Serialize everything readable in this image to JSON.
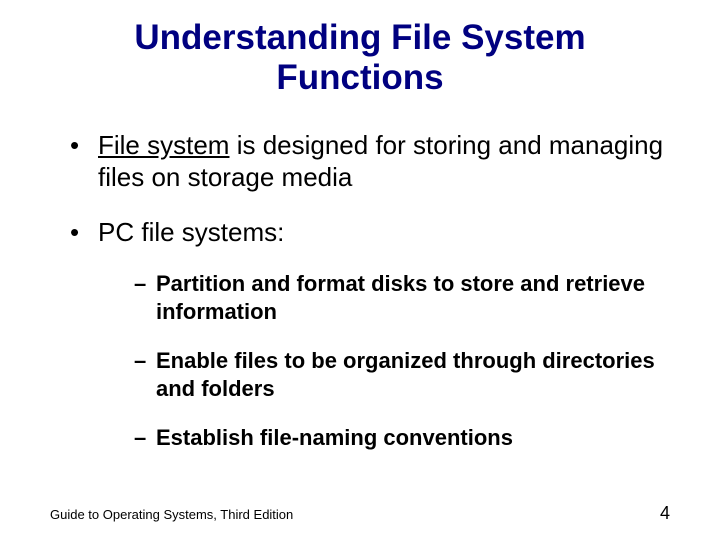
{
  "title": "Understanding File System Functions",
  "bullets": [
    {
      "prefix": "File system",
      "rest": " is designed for storing and managing files on storage media"
    },
    {
      "prefix": "",
      "rest": "PC file systems:"
    }
  ],
  "subbullets": [
    "Partition and format disks to store and retrieve information",
    "Enable files to be organized through directories and folders",
    "Establish file-naming conventions"
  ],
  "footer": {
    "left": "Guide to Operating Systems, Third Edition",
    "right": "4"
  }
}
